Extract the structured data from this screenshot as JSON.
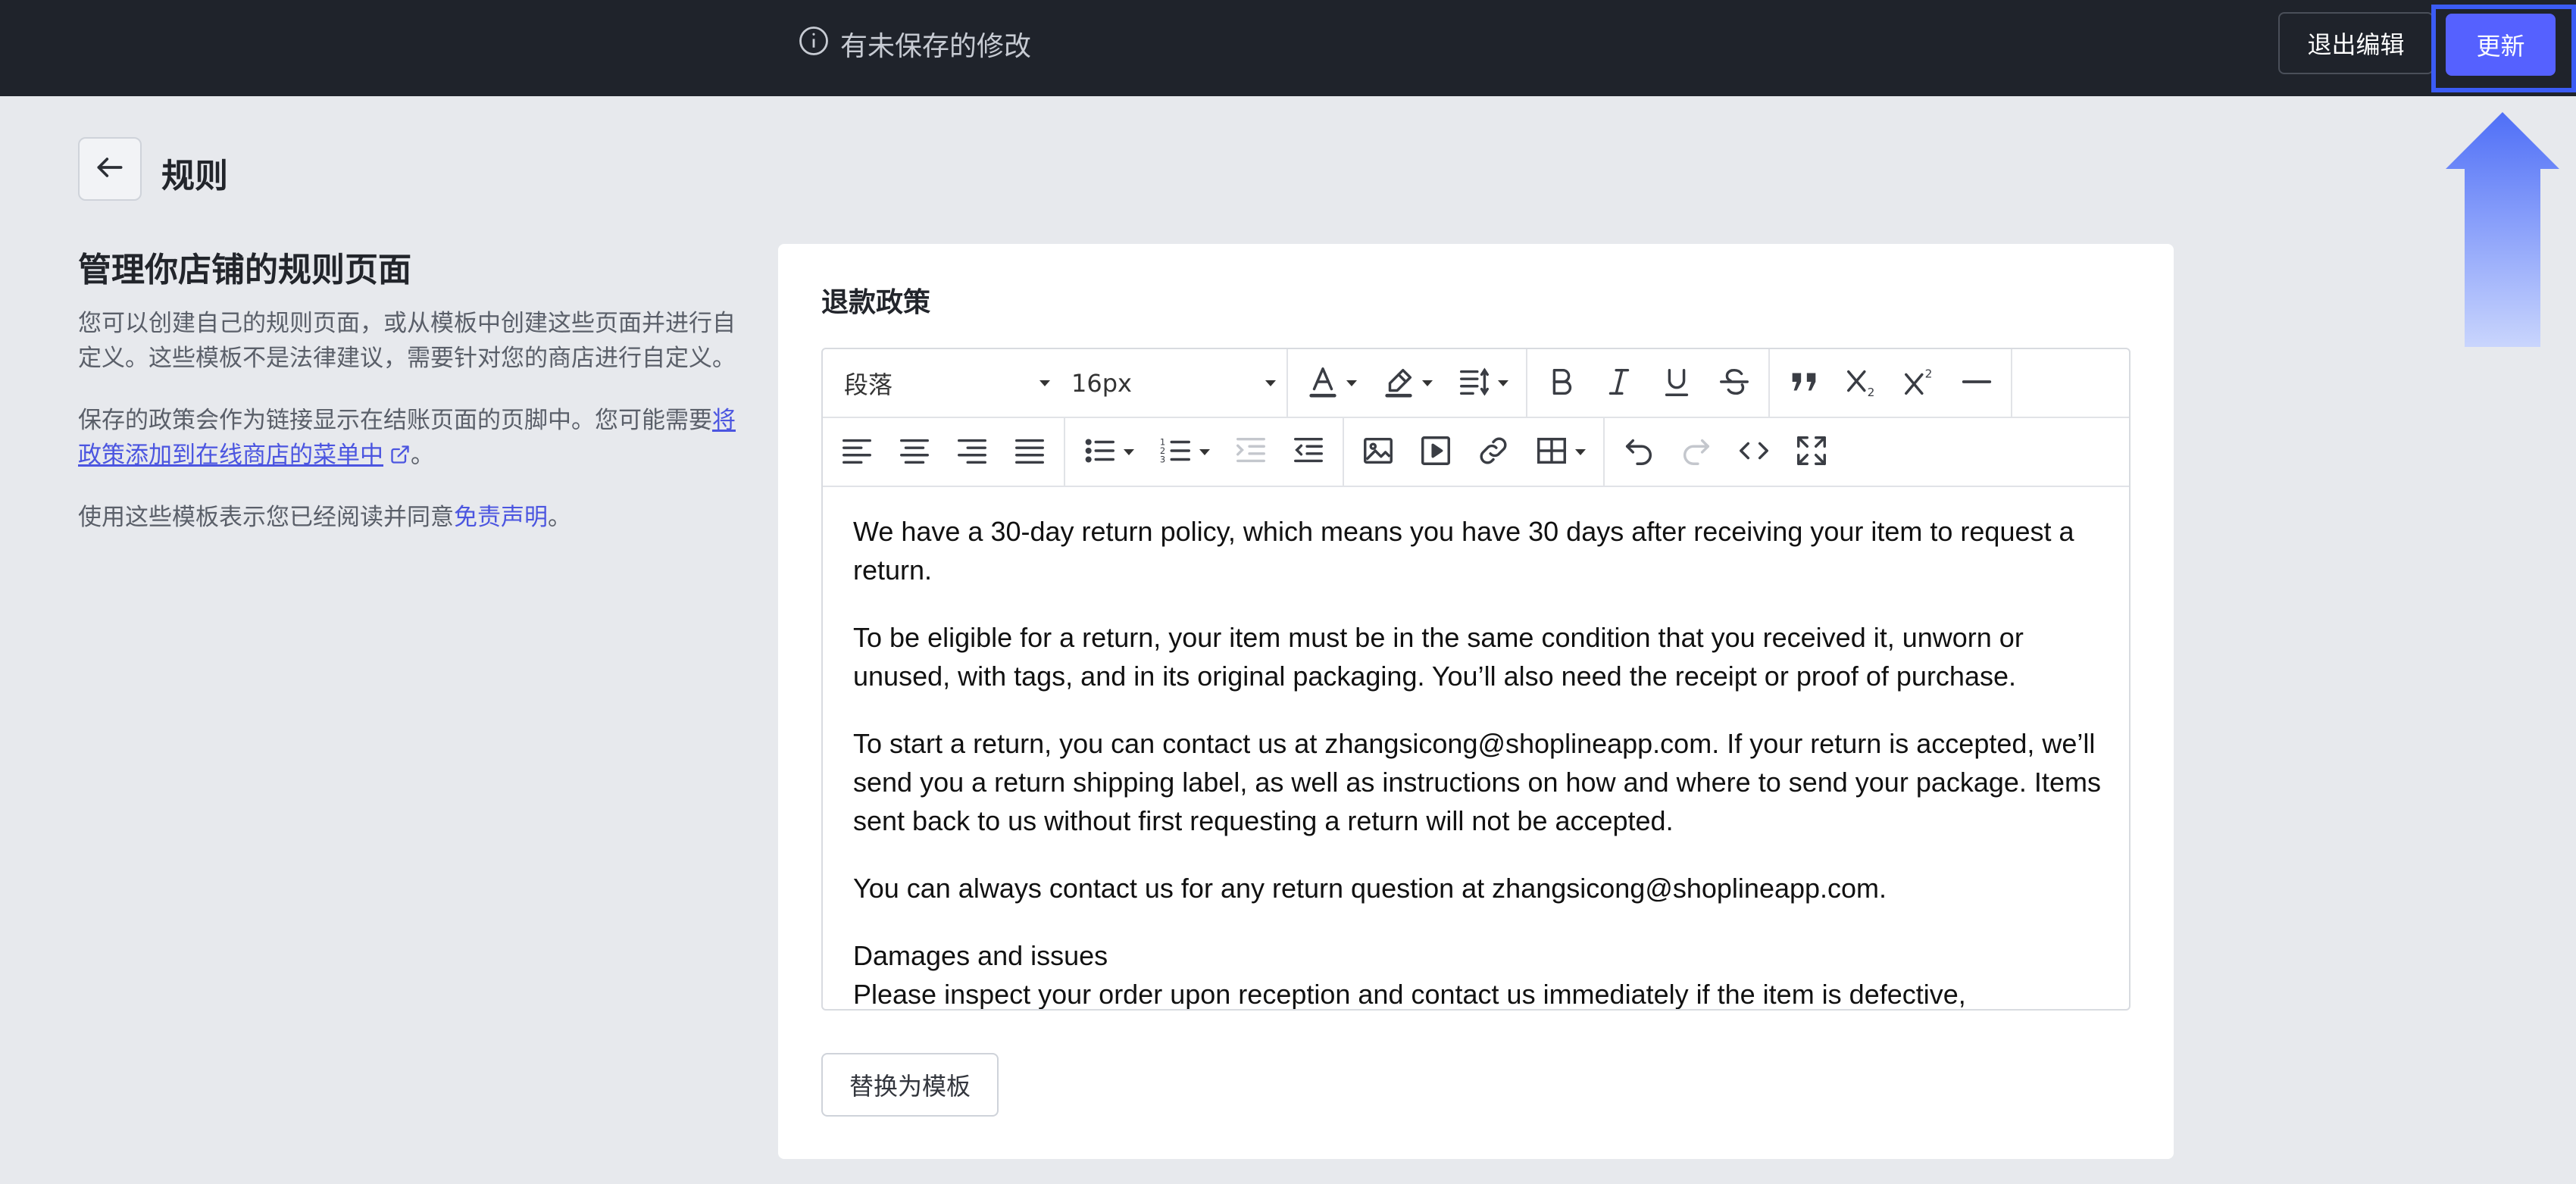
{
  "topbar": {
    "unsaved_text": "有未保存的修改",
    "exit_label": "退出编辑",
    "update_label": "更新",
    "accent_color": "#5561ff"
  },
  "header": {
    "back_icon": "arrow-left-icon",
    "title": "规则"
  },
  "left": {
    "heading": "管理你店铺的规则页面",
    "p1": "您可以创建自己的规则页面，或从模板中创建这些页面并进行自定义。这些模板不是法律建议，需要针对您的商店进行自定义。",
    "p2_prefix": "保存的政策会作为链接显示在结账页面的页脚中。您可能需要",
    "p2_link": "将政策添加到在线商店的菜单中",
    "p2_suffix": "。",
    "p3_prefix": "使用这些模板表示您已经阅读并同意",
    "p3_link": "免责声明",
    "p3_suffix": "。"
  },
  "card": {
    "title": "退款政策",
    "toolbar": {
      "paragraph_select": "段落",
      "font_size_select": "16px"
    },
    "content": {
      "p1": "We have a 30-day return policy, which means you have 30 days after receiving your item to request a return.",
      "p2": "To be eligible for a return, your item must be in the same condition that you received it, unworn or unused, with tags, and in its original packaging. You’ll also need the receipt or proof of purchase.",
      "p3": "To start a return, you can contact us at zhangsicong@shoplineapp.com. If your return is accepted, we’ll send you a return shipping label, as well as instructions on how and where to send your package. Items sent back to us without first requesting a return will not be accepted.",
      "p4": "You can always contact us for any return question at zhangsicong@shoplineapp.com.",
      "p5": "Damages and issues",
      "p6": "Please inspect your order upon reception and contact us immediately if the item is defective,"
    },
    "replace_label": "替换为模板"
  }
}
